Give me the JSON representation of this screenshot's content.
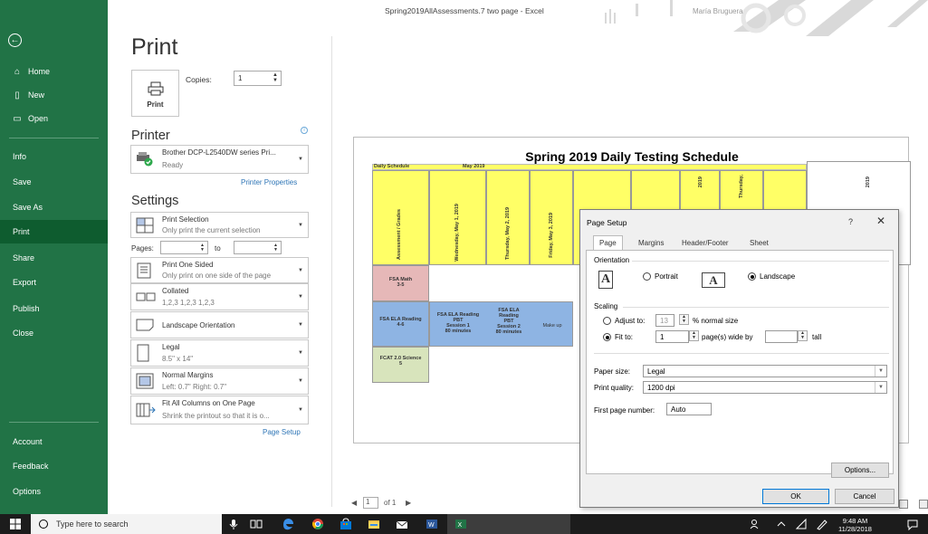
{
  "window": {
    "title": "Spring2019AllAssessments.7 two page  -  Excel",
    "user": "María Bruguera"
  },
  "sidebar": {
    "back_icon": "back-arrow-icon",
    "items": [
      {
        "label": "Home",
        "icon": "home-icon"
      },
      {
        "label": "New",
        "icon": "new-doc-icon"
      },
      {
        "label": "Open",
        "icon": "folder-open-icon"
      },
      {
        "label": "Info"
      },
      {
        "label": "Save"
      },
      {
        "label": "Save As"
      },
      {
        "label": "Print",
        "active": true
      },
      {
        "label": "Share"
      },
      {
        "label": "Export"
      },
      {
        "label": "Publish"
      },
      {
        "label": "Close"
      },
      {
        "label": "Account"
      },
      {
        "label": "Feedback"
      },
      {
        "label": "Options"
      }
    ]
  },
  "print": {
    "heading": "Print",
    "button_label": "Print",
    "copies_label": "Copies:",
    "copies_value": "1"
  },
  "printer": {
    "heading": "Printer",
    "name": "Brother DCP-L2540DW series Pri...",
    "status": "Ready",
    "properties_link": "Printer Properties"
  },
  "settings": {
    "heading": "Settings",
    "selection": {
      "title": "Print Selection",
      "sub": "Only print the current selection"
    },
    "pages_label": "Pages:",
    "to_label": "to",
    "sided": {
      "title": "Print One Sided",
      "sub": "Only print on one side of the page"
    },
    "collated": {
      "title": "Collated",
      "sub": "1,2,3   1,2,3   1,2,3"
    },
    "orientation": {
      "title": "Landscape Orientation"
    },
    "paper": {
      "title": "Legal",
      "sub": "8.5\" x 14\""
    },
    "margins": {
      "title": "Normal Margins",
      "sub": "Left: 0.7\"   Right: 0.7\""
    },
    "scaling": {
      "title": "Fit All Columns on One Page",
      "sub": "Shrink the printout so that it is o..."
    },
    "page_setup_link": "Page Setup"
  },
  "preview": {
    "sheet_title": "Spring 2019 Daily Testing Schedule",
    "header_left": "Daily Schedule",
    "header_month": "May 2019",
    "col_headers": [
      "Assessment / Grades",
      "Wednesday, May 1, 2019",
      "Thursday, May 2, 2019",
      "Friday, May 3, 2019"
    ],
    "partial_headers": [
      "2019",
      "Thursday,",
      "2019"
    ],
    "rows": [
      {
        "label": "FSA Math\n3-5",
        "color": "#e6b8b8"
      },
      {
        "label": "FSA ELA Reading\n4-6",
        "color": "#8eb4e3",
        "cells": [
          "FSA ELA Reading\nPBT\nSession 1\n80 minutes",
          "FSA ELA\nReading\nPBT\nSession 2\n80 minutes",
          "Make up"
        ]
      },
      {
        "label": "FCAT 2.0 Science\n5",
        "color": "#d8e4bc"
      }
    ],
    "page_nav": {
      "current": "1",
      "of": "of 1"
    }
  },
  "dialog": {
    "title": "Page Setup",
    "help": "?",
    "close": "✕",
    "tabs": [
      "Page",
      "Margins",
      "Header/Footer",
      "Sheet"
    ],
    "orientation_label": "Orientation",
    "portrait": "Portrait",
    "landscape": "Landscape",
    "scaling_label": "Scaling",
    "adjust_to": "Adjust to:",
    "adjust_value": "13",
    "normal_size": "% normal size",
    "fit_to": "Fit to:",
    "fit_wide_value": "1",
    "pages_wide": "page(s) wide by",
    "tall_value": "",
    "tall": "tall",
    "paper_size_label": "Paper size:",
    "paper_size": "Legal",
    "print_quality_label": "Print quality:",
    "print_quality": "1200 dpi",
    "first_page_label": "First page number:",
    "first_page_value": "Auto",
    "options_btn": "Options...",
    "ok_btn": "OK",
    "cancel_btn": "Cancel"
  },
  "taskbar": {
    "search_placeholder": "Type here to search",
    "time": "9:48 AM",
    "date": "11/28/2018"
  },
  "colors": {
    "excel_green": "#217346",
    "active_nav": "#0e5c2f",
    "yellow": "#ffff66"
  }
}
